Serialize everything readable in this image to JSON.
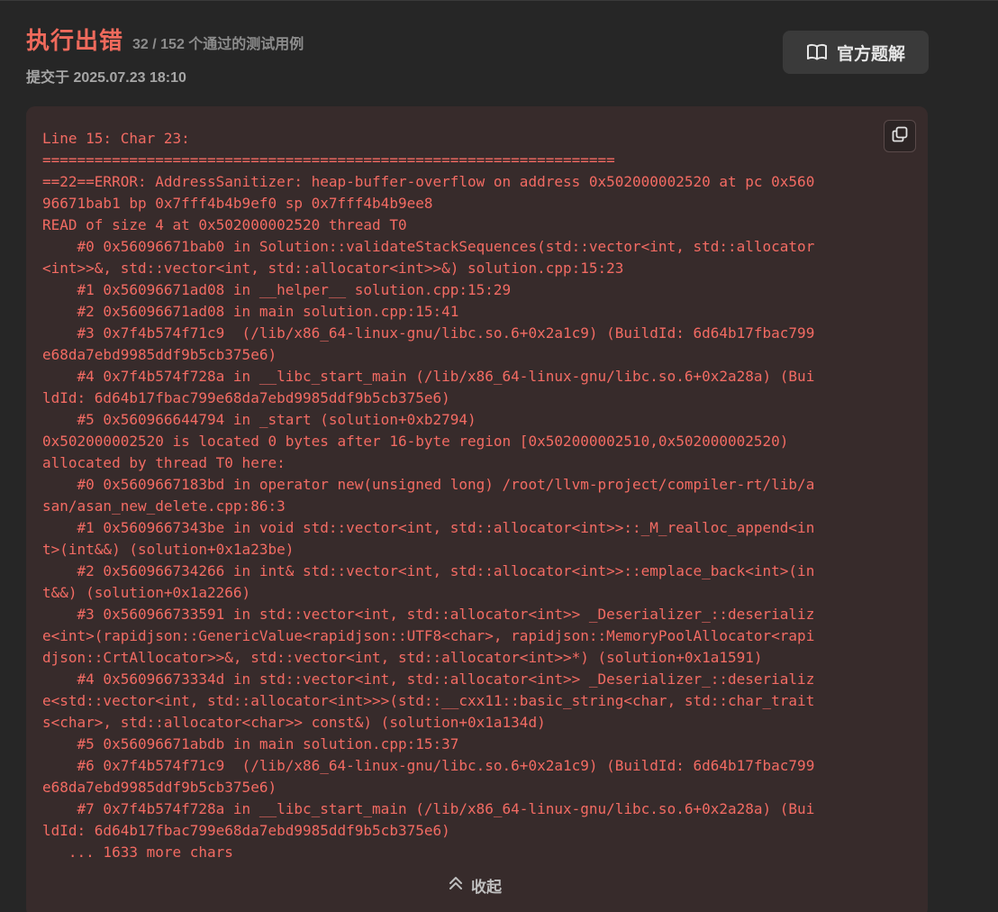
{
  "header": {
    "status": "执行出错",
    "pass_count": "32 / 152 个通过的测试用例",
    "submitted": "提交于 2025.07.23 18:10"
  },
  "solution_button": {
    "label": "官方题解",
    "icon": "book-open-icon"
  },
  "error": {
    "lines": [
      "Line 15: Char 23:",
      "==================================================================",
      "==22==ERROR: AddressSanitizer: heap-buffer-overflow on address 0x502000002520 at pc 0x560",
      "96671bab1 bp 0x7fff4b4b9ef0 sp 0x7fff4b4b9ee8",
      "READ of size 4 at 0x502000002520 thread T0",
      "    #0 0x56096671bab0 in Solution::validateStackSequences(std::vector<int, std::allocator",
      "<int>>&, std::vector<int, std::allocator<int>>&) solution.cpp:15:23",
      "    #1 0x56096671ad08 in __helper__ solution.cpp:15:29",
      "    #2 0x56096671ad08 in main solution.cpp:15:41",
      "    #3 0x7f4b574f71c9  (/lib/x86_64-linux-gnu/libc.so.6+0x2a1c9) (BuildId: 6d64b17fbac799",
      "e68da7ebd9985ddf9b5cb375e6)",
      "    #4 0x7f4b574f728a in __libc_start_main (/lib/x86_64-linux-gnu/libc.so.6+0x2a28a) (Bui",
      "ldId: 6d64b17fbac799e68da7ebd9985ddf9b5cb375e6)",
      "    #5 0x560966644794 in _start (solution+0xb2794)",
      "0x502000002520 is located 0 bytes after 16-byte region [0x502000002510,0x502000002520)",
      "allocated by thread T0 here:",
      "    #0 0x5609667183bd in operator new(unsigned long) /root/llvm-project/compiler-rt/lib/a",
      "san/asan_new_delete.cpp:86:3",
      "    #1 0x5609667343be in void std::vector<int, std::allocator<int>>::_M_realloc_append<in",
      "t>(int&&) (solution+0x1a23be)",
      "    #2 0x560966734266 in int& std::vector<int, std::allocator<int>>::emplace_back<int>(in",
      "t&&) (solution+0x1a2266)",
      "    #3 0x560966733591 in std::vector<int, std::allocator<int>> _Deserializer_::deserializ",
      "e<int>(rapidjson::GenericValue<rapidjson::UTF8<char>, rapidjson::MemoryPoolAllocator<rapi",
      "djson::CrtAllocator>>&, std::vector<int, std::allocator<int>>*) (solution+0x1a1591)",
      "    #4 0x56096673334d in std::vector<int, std::allocator<int>> _Deserializer_::deserializ",
      "e<std::vector<int, std::allocator<int>>>(std::__cxx11::basic_string<char, std::char_trait",
      "s<char>, std::allocator<char>> const&) (solution+0x1a134d)",
      "    #5 0x56096671abdb in main solution.cpp:15:37",
      "    #6 0x7f4b574f71c9  (/lib/x86_64-linux-gnu/libc.so.6+0x2a1c9) (BuildId: 6d64b17fbac799",
      "e68da7ebd9985ddf9b5cb375e6)",
      "    #7 0x7f4b574f728a in __libc_start_main (/lib/x86_64-linux-gnu/libc.so.6+0x2a28a) (Bui",
      "ldId: 6d64b17fbac799e68da7ebd9985ddf9b5cb375e6)",
      "   ... 1633 more chars"
    ],
    "copy_icon": "copy-icon"
  },
  "collapse": {
    "label": "收起",
    "icon": "chevrons-up-icon"
  },
  "colors": {
    "error_red": "#ef6a5c",
    "panel_bg": "#372b2b",
    "page_bg": "#262626"
  }
}
